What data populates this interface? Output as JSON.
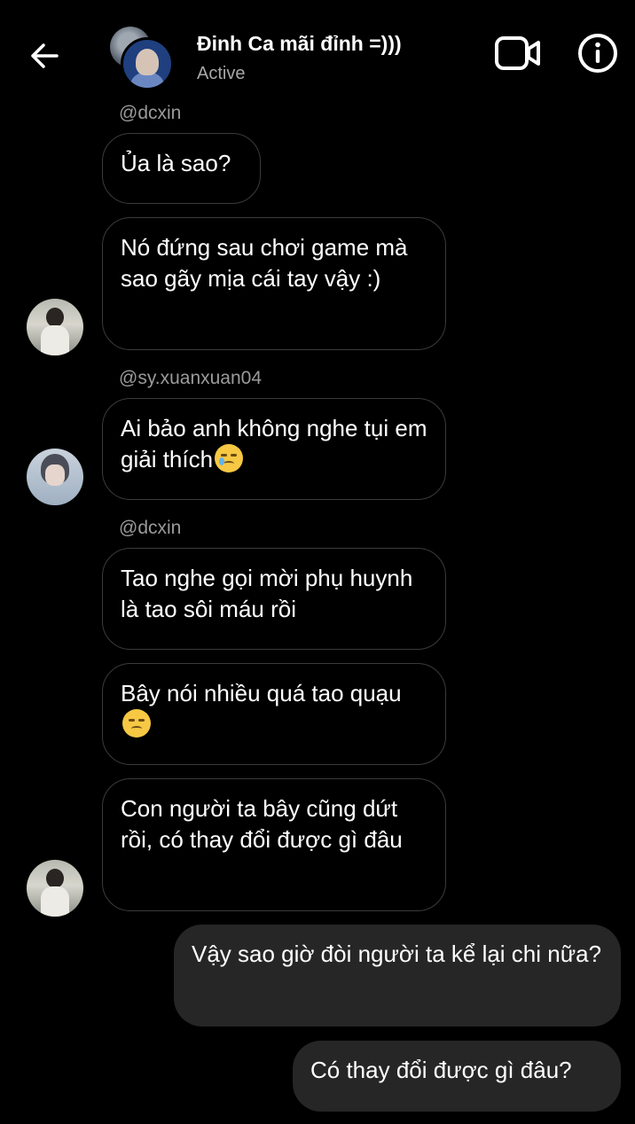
{
  "header": {
    "title": "Đinh Ca mãi đỉnh =)))",
    "status": "Active",
    "icons": [
      "back-arrow-icon",
      "video-camera-icon",
      "info-icon"
    ]
  },
  "messages": [
    {
      "sender": "@dcxin",
      "text": "Ủa là sao?"
    },
    {
      "text": "Nó đứng sau chơi game mà sao gãy mịa cái tay vậy :)"
    },
    {
      "sender": "@sy.xuanxuan04",
      "text": "Ai bảo anh không nghe tụi em giải thích",
      "emoji": "crying-face-emoji"
    },
    {
      "sender": "@dcxin",
      "text": "Tao nghe gọi mời phụ huynh là tao sôi máu rồi"
    },
    {
      "text": "Bây nói nhiều quá tao quạu",
      "emoji": "unamused-face-emoji"
    },
    {
      "text": "Con người ta bây cũng dứt rồi, có thay đổi được gì đâu"
    },
    {
      "outgoing": true,
      "text": "Vậy sao giờ đòi người ta kể lại chi nữa?"
    },
    {
      "outgoing": true,
      "text": "Có thay đổi được gì đâu?"
    }
  ],
  "colors": {
    "background": "#000000",
    "incoming_border": "#3b3b3b",
    "outgoing_bg": "#262626",
    "username": "#9a9a9a"
  }
}
